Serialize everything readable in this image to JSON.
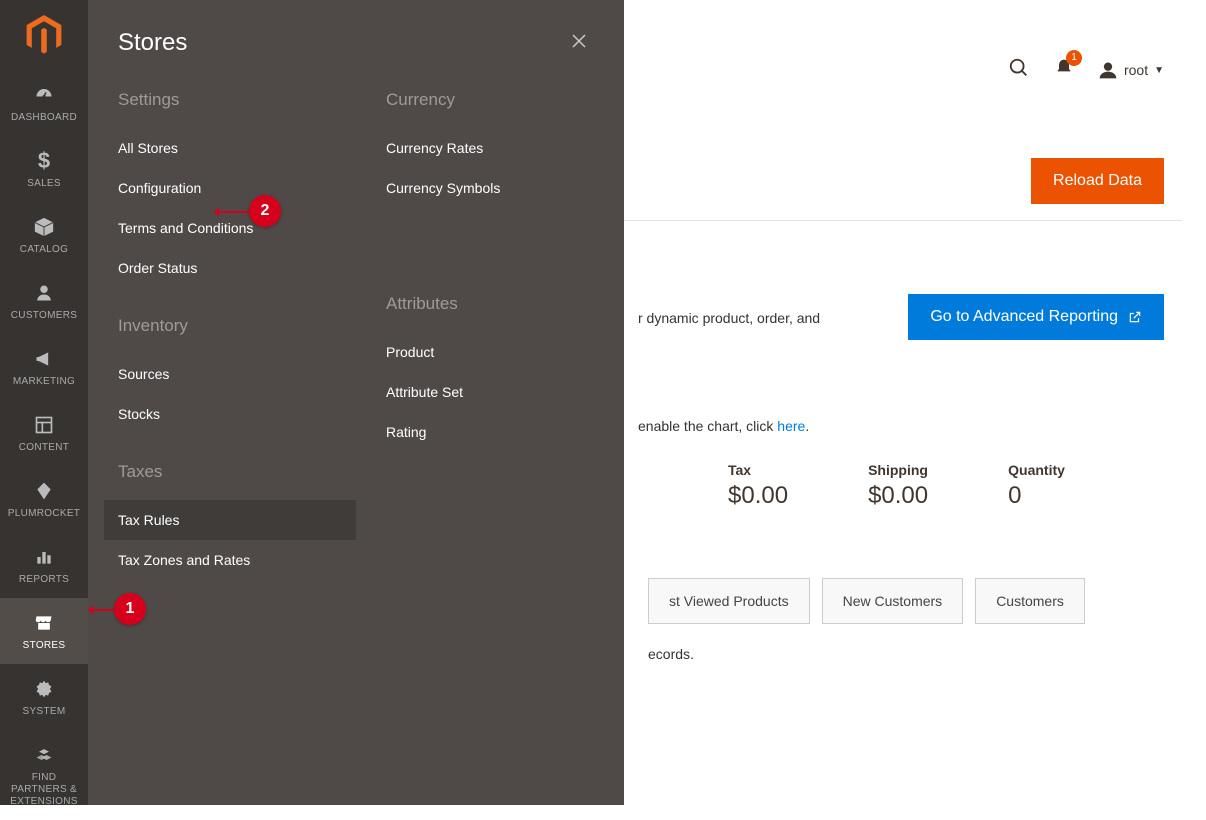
{
  "sidebar": {
    "items": [
      {
        "label": "DASHBOARD",
        "icon": "gauge"
      },
      {
        "label": "SALES",
        "icon": "dollar"
      },
      {
        "label": "CATALOG",
        "icon": "box"
      },
      {
        "label": "CUSTOMERS",
        "icon": "person"
      },
      {
        "label": "MARKETING",
        "icon": "megaphone"
      },
      {
        "label": "CONTENT",
        "icon": "layout"
      },
      {
        "label": "PLUMROCKET",
        "icon": "diamond"
      },
      {
        "label": "REPORTS",
        "icon": "chart"
      },
      {
        "label": "STORES",
        "icon": "store"
      },
      {
        "label": "SYSTEM",
        "icon": "gear"
      },
      {
        "label": "FIND PARTNERS & EXTENSIONS",
        "icon": "cubes"
      }
    ]
  },
  "flyout": {
    "title": "Stores",
    "col1": {
      "settings": {
        "title": "Settings",
        "items": [
          "All Stores",
          "Configuration",
          "Terms and Conditions",
          "Order Status"
        ]
      },
      "inventory": {
        "title": "Inventory",
        "items": [
          "Sources",
          "Stocks"
        ]
      },
      "taxes": {
        "title": "Taxes",
        "items": [
          "Tax Rules",
          "Tax Zones and Rates"
        ]
      }
    },
    "col2": {
      "currency": {
        "title": "Currency",
        "items": [
          "Currency Rates",
          "Currency Symbols"
        ]
      },
      "attributes": {
        "title": "Attributes",
        "items": [
          "Product",
          "Attribute Set",
          "Rating"
        ]
      }
    }
  },
  "annotations": {
    "badge1": "1",
    "badge2": "2"
  },
  "header": {
    "notifications_count": "1",
    "username": "root"
  },
  "actions": {
    "reload_label": "Reload Data",
    "advanced_label": "Go to Advanced Reporting"
  },
  "page": {
    "adv_text_fragment": "r dynamic product, order, and",
    "chart_disabled_prefix": "enable the chart, click ",
    "chart_link": "here",
    "stats": [
      {
        "label": "Tax",
        "value": "$0.00"
      },
      {
        "label": "Shipping",
        "value": "$0.00"
      },
      {
        "label": "Quantity",
        "value": "0"
      }
    ],
    "tabs": [
      "st Viewed Products",
      "New Customers",
      "Customers"
    ],
    "records_fragment": "ecords."
  }
}
